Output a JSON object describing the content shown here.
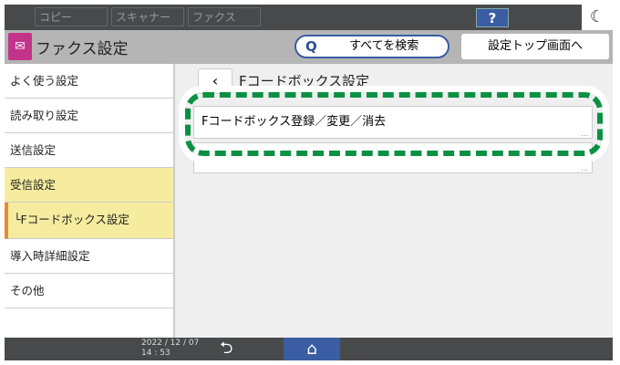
{
  "topbar": {
    "tabs": [
      "コピー",
      "スキャナー",
      "ファクス"
    ],
    "help": "?",
    "moon": "☾"
  },
  "header": {
    "title": "ファクス設定",
    "search_label": "すべてを検索",
    "top_label": "設定トップ画面へ"
  },
  "sidebar": {
    "items": [
      {
        "label": "よく使う設定"
      },
      {
        "label": "読み取り設定"
      },
      {
        "label": "送信設定"
      },
      {
        "label": "受信設定",
        "selected": true
      },
      {
        "label": "└Fコードボックス設定",
        "selected": true
      },
      {
        "label": "導入時詳細設定"
      },
      {
        "label": "その他"
      }
    ]
  },
  "main": {
    "back": "‹",
    "title": "Fコードボックス設定",
    "rows": [
      {
        "label": "Fコードボックス登録／変更／消去"
      },
      {
        "label": ""
      }
    ],
    "more": "..."
  },
  "footer": {
    "date": "2022 / 12 / 07",
    "time": "14 : 53",
    "undo": "⮌",
    "home": "⌂"
  },
  "colors": {
    "highlight": "#0a9142",
    "accent": "#3a5da3",
    "selected": "#f6eca0"
  }
}
